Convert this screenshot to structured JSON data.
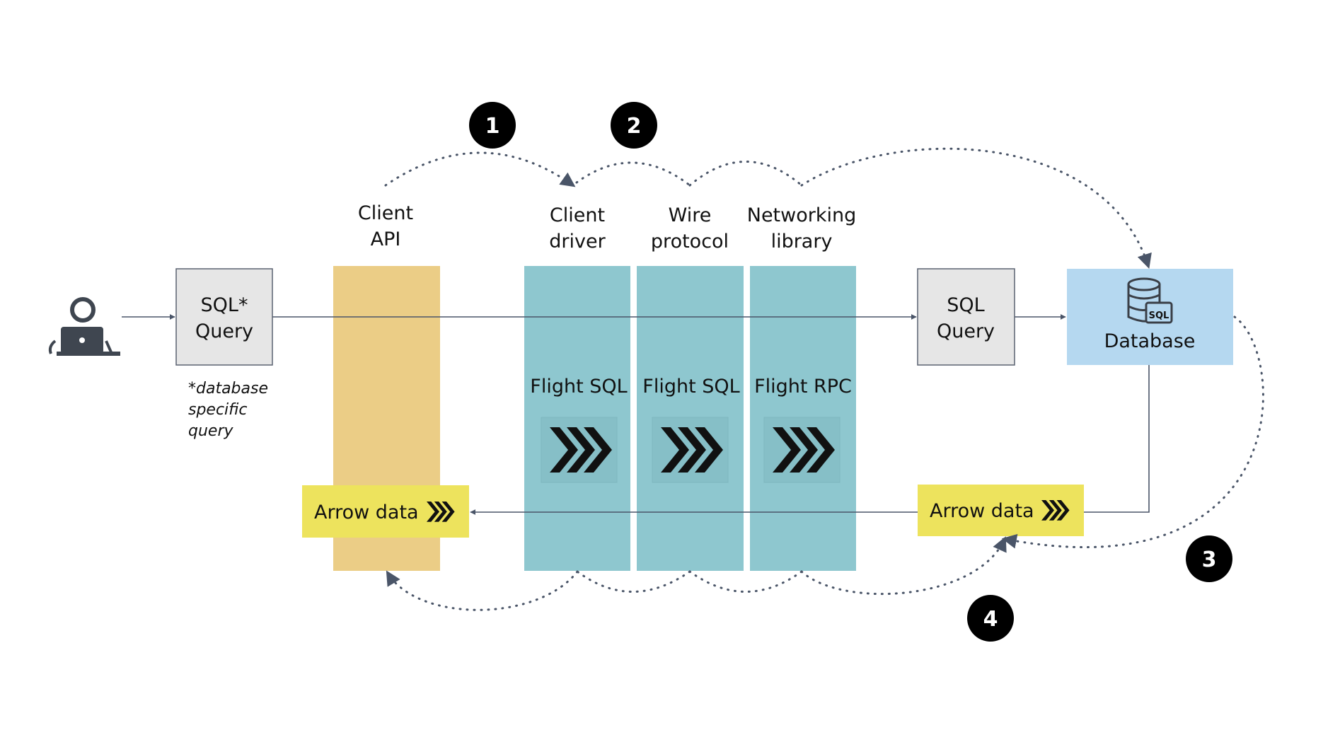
{
  "diagram": {
    "user_icon": "person-laptop-icon",
    "input_query": {
      "line1": "SQL*",
      "line2": "Query"
    },
    "footnote": [
      "*database",
      "specific",
      "query"
    ],
    "layers": [
      {
        "label1": "Client",
        "label2": "API",
        "color": "#ebcd86"
      },
      {
        "label1": "Client",
        "label2": "driver",
        "protocol": "Flight SQL",
        "color": "#8ec7cf"
      },
      {
        "label1": "Wire",
        "label2": "protocol",
        "protocol": "Flight SQL",
        "color": "#8ec7cf"
      },
      {
        "label1": "Networking",
        "label2": "library",
        "protocol": "Flight RPC",
        "color": "#8ec7cf"
      }
    ],
    "output_query": {
      "line1": "SQL",
      "line2": "Query"
    },
    "database": {
      "label": "Database",
      "icon": "database-sql-icon",
      "icon_text": "SQL",
      "color": "#b5d8f0"
    },
    "arrow_data_client": {
      "label": "Arrow data",
      "icon": "arrow-chevrons-icon",
      "color": "#ede35d"
    },
    "arrow_data_server": {
      "label": "Arrow data",
      "icon": "arrow-chevrons-icon",
      "color": "#ede35d"
    },
    "steps": [
      "1",
      "2",
      "3",
      "4"
    ]
  }
}
